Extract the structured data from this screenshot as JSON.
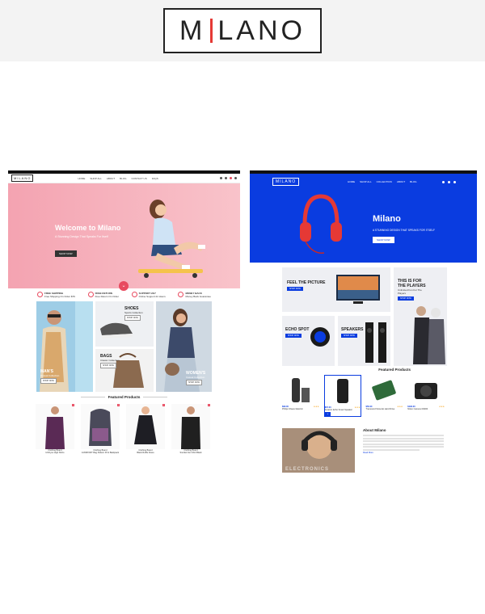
{
  "brand": {
    "logo_left": "M",
    "logo_right": "LANO"
  },
  "left": {
    "logo": "MILANO",
    "menu": [
      "HOME",
      "SHOP ALL",
      "ABOUT",
      "BLOG",
      "CONTACT US",
      "FAQS"
    ],
    "hero": {
      "title": "Welcome to Milano",
      "subtitle": "A Stunning Design That Speaks For Itself",
      "button": "SHOP NOW"
    },
    "features": [
      {
        "title": "FREE SHIPPING",
        "text": "Free Shipping On Order $79"
      },
      {
        "title": "FREE RETURN",
        "text": "Free Return On Order"
      },
      {
        "title": "SUPPORT 24/7",
        "text": "Online Support 24 Hours"
      },
      {
        "title": "MONEY BACK",
        "text": "Money Back Guarantee"
      }
    ],
    "banners": {
      "man": {
        "title": "MAN'S",
        "sub": "Casual Collection",
        "btn": "SHOP NOW"
      },
      "shoes": {
        "title": "SHOES",
        "sub": "Sports Collection",
        "btn": "SHOP NOW"
      },
      "bags": {
        "title": "BAGS",
        "sub": "Classic Collection",
        "btn": "SHOP NOW"
      },
      "women": {
        "title": "WOMEN'S",
        "sub": "Casual Collection",
        "btn": "SHOP NOW"
      }
    },
    "featured_title": "Featured Products",
    "products": [
      {
        "vendor": "Clothing Brand",
        "name": "Ichthyus High Shirts"
      },
      {
        "vendor": "Clothing Brand",
        "name": "JANSPORT Bag Pattern Print Backpack"
      },
      {
        "vendor": "Clothing Brand",
        "name": "Black Ruffle Dress"
      },
      {
        "vendor": "Clothing Brand",
        "name": "Snorkel Fan Shirt Black"
      }
    ]
  },
  "right": {
    "logo": "MILANO",
    "menu": [
      "HOME",
      "SHOP ALL",
      "COLLECTION",
      "ABOUT",
      "BLOG"
    ],
    "hero": {
      "title": "Milano",
      "subtitle": "A STUNNING DESIGN THAT SPEAKS FOR ITSELF",
      "button": "SHOP NOW"
    },
    "banners": {
      "picture": {
        "title": "FEEL THE PICTURE",
        "btn": "SHOP NOW"
      },
      "players": {
        "title": "THIS IS FOR THE PLAYERS",
        "sub": "Unlimited Fun For The Players",
        "btn": "SHOP NOW"
      },
      "echo": {
        "title": "ECHO SPOT",
        "btn": "SHOP NOW"
      },
      "speakers": {
        "title": "SPEAKERS",
        "btn": "SHOP NOW"
      }
    },
    "featured_title": "Featured Products",
    "products": [
      {
        "price": "$90.00",
        "name": "Philips Shaver Electric"
      },
      {
        "price": "$67.00",
        "name": "Amazon Echo Smart Speaker"
      },
      {
        "price": "$50.00",
        "name": "Transcend StoreJet Hard Drive"
      },
      {
        "price": "$190.00",
        "name": "Nikon Camera D3300"
      }
    ],
    "about": {
      "title": "About Milano",
      "link": "Read More",
      "image_text": "ELECTRONICS"
    }
  },
  "colors": {
    "accent_pink": "#e84a5f",
    "accent_blue": "#0a3ce0"
  }
}
